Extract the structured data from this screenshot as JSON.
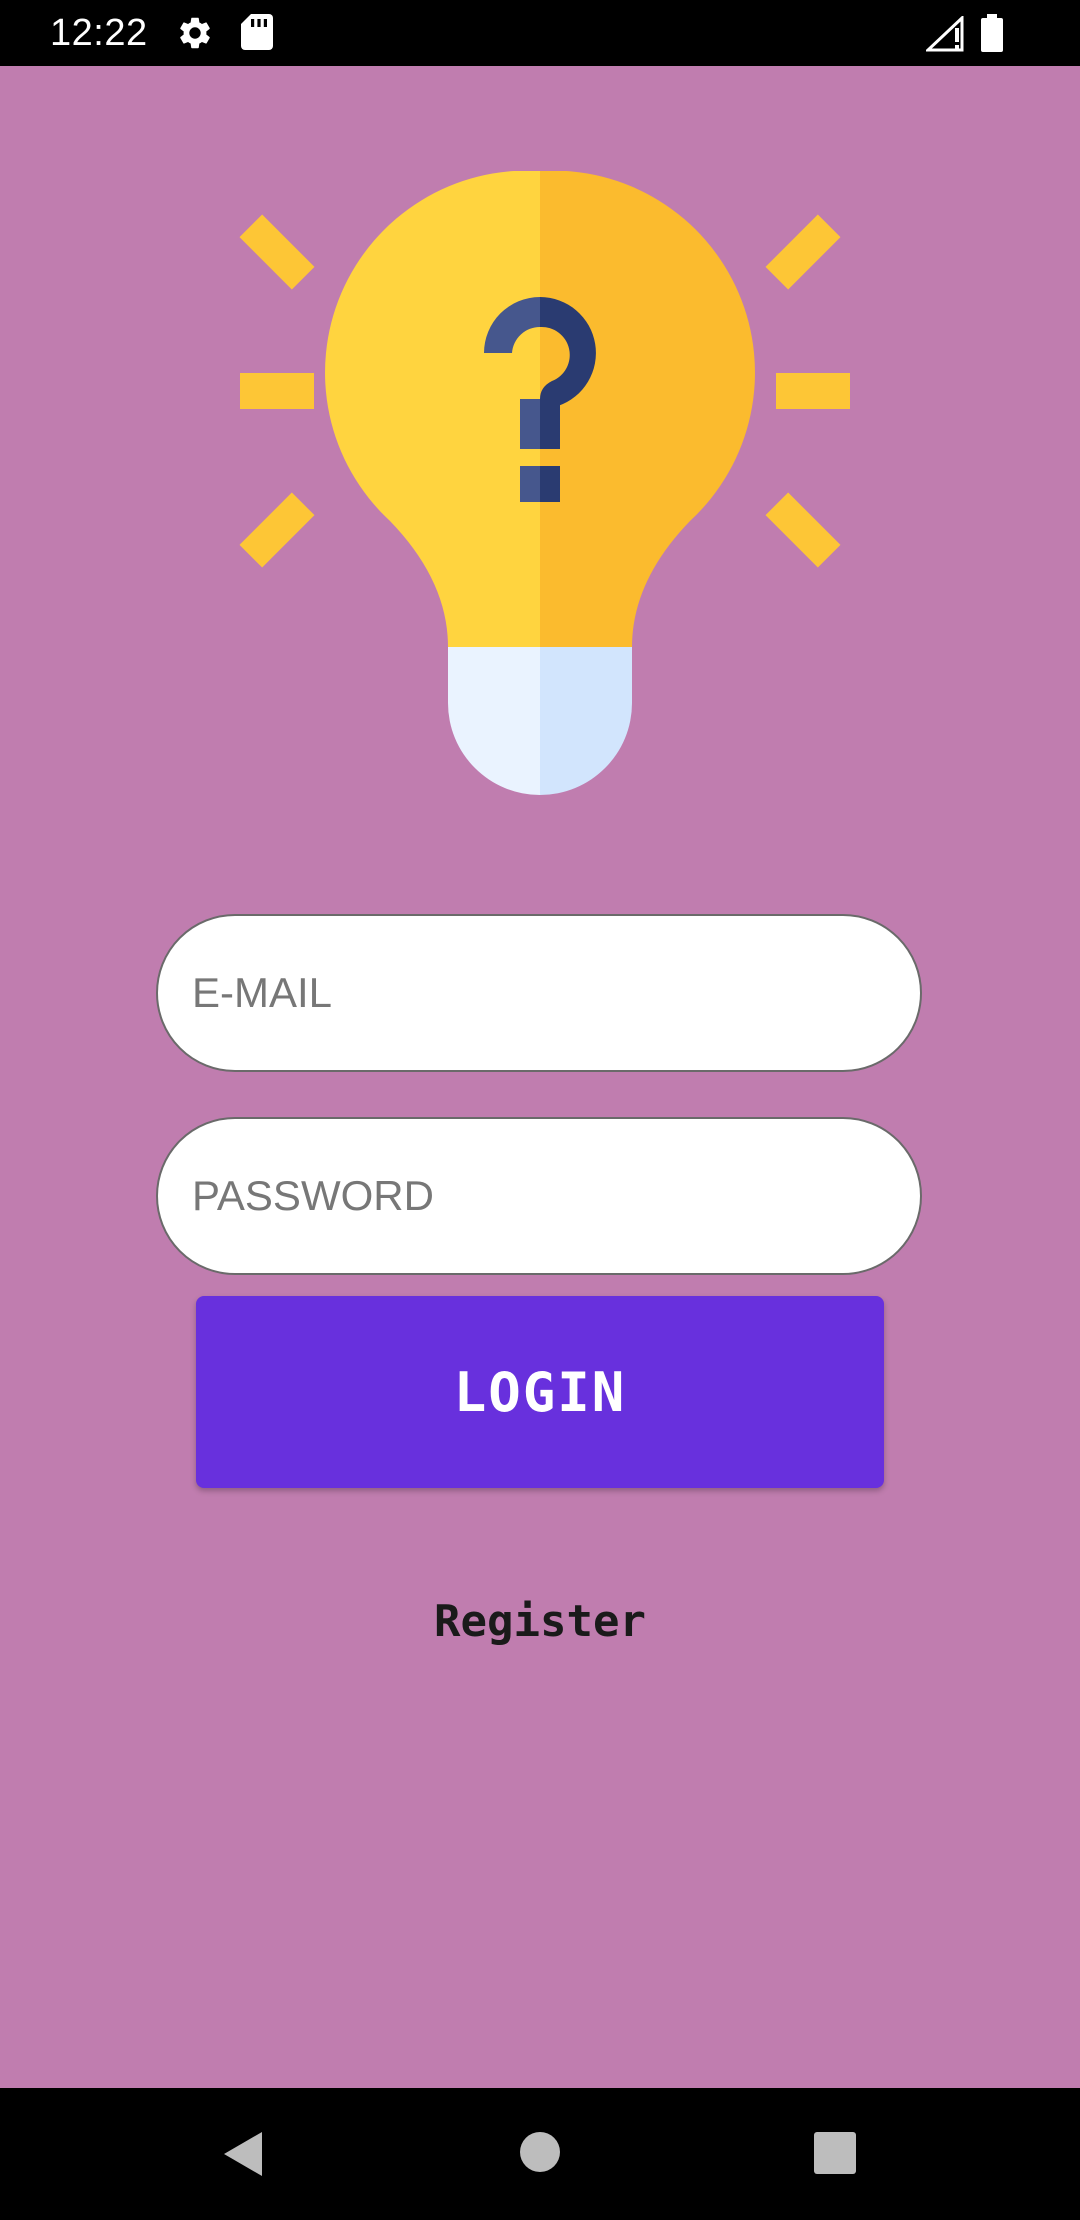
{
  "status_bar": {
    "time": "12:22",
    "icons": [
      "settings-icon",
      "sd-card-icon",
      "signal-icon",
      "battery-icon"
    ]
  },
  "logo": {
    "icon": "lightbulb-question-icon",
    "colors": {
      "bulb_left": "#ffd43f",
      "bulb_right": "#fbbb2e",
      "base_left": "#eaf3ff",
      "base_right": "#d2e5fd",
      "question_left": "#46578d",
      "question_right": "#2a3b71",
      "rays": "#fdc636"
    }
  },
  "form": {
    "email": {
      "placeholder": "E-MAIL",
      "value": ""
    },
    "password": {
      "placeholder": "PASSWORD",
      "value": ""
    }
  },
  "actions": {
    "login_label": "LOGIN",
    "register_label": "Register"
  },
  "nav_bar": {
    "buttons": [
      "back-icon",
      "home-icon",
      "recents-icon"
    ]
  },
  "colors": {
    "background": "#c07daf",
    "login_button": "#6830dd",
    "system_bars": "#000000"
  }
}
